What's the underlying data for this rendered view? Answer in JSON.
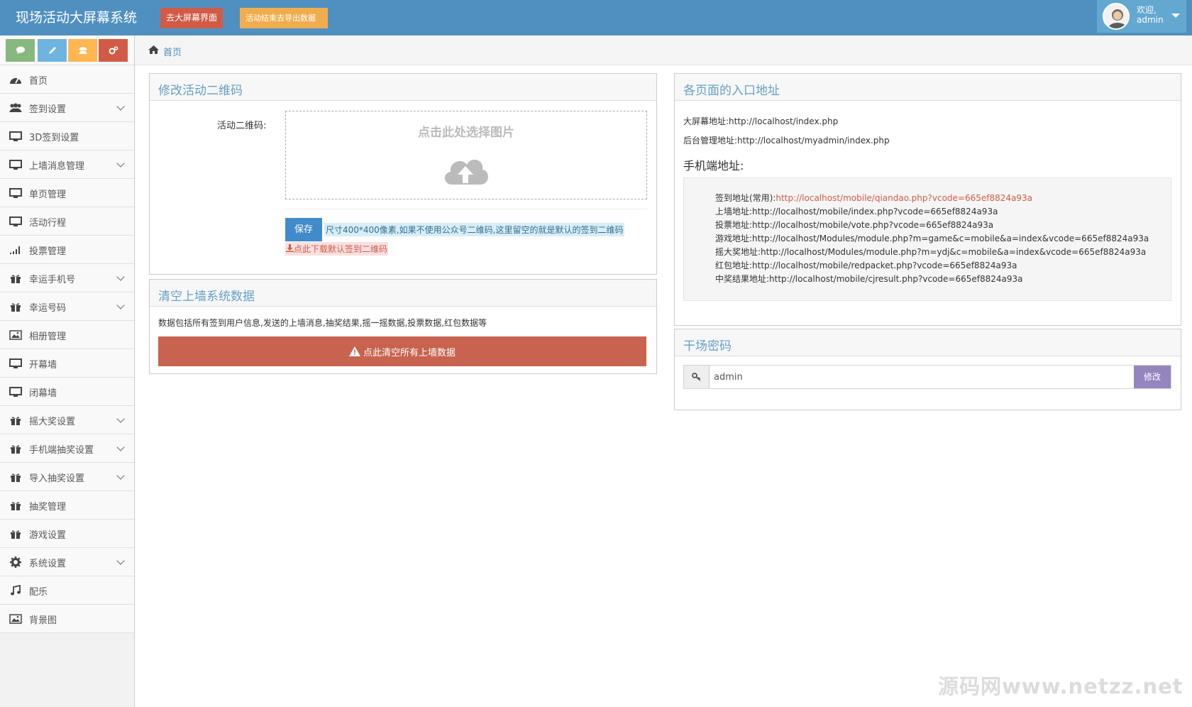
{
  "header": {
    "brand": "现场活动大屏幕系统",
    "screen_button": "去大屏幕界面",
    "export_button": "活动结束去导出数据",
    "welcome": "欢迎,",
    "user": "admin"
  },
  "sidebar": {
    "items": [
      {
        "label": "首页",
        "icon": "dashboard-icon",
        "has_children": false
      },
      {
        "label": "签到设置",
        "icon": "users-icon",
        "has_children": true
      },
      {
        "label": "3D签到设置",
        "icon": "desktop-icon",
        "has_children": false
      },
      {
        "label": "上墙消息管理",
        "icon": "desktop-icon",
        "has_children": true
      },
      {
        "label": "单页管理",
        "icon": "desktop-icon",
        "has_children": false
      },
      {
        "label": "活动行程",
        "icon": "desktop-icon",
        "has_children": false
      },
      {
        "label": "投票管理",
        "icon": "signal-icon",
        "has_children": false
      },
      {
        "label": "幸运手机号",
        "icon": "gift-icon",
        "has_children": true
      },
      {
        "label": "幸运号码",
        "icon": "gift-icon",
        "has_children": true
      },
      {
        "label": "相册管理",
        "icon": "picture-icon",
        "has_children": false
      },
      {
        "label": "开幕墙",
        "icon": "desktop-icon",
        "has_children": false
      },
      {
        "label": "闭幕墙",
        "icon": "desktop-icon",
        "has_children": false
      },
      {
        "label": "摇大奖设置",
        "icon": "gift-icon",
        "has_children": true
      },
      {
        "label": "手机端抽奖设置",
        "icon": "gift-icon",
        "has_children": true
      },
      {
        "label": "导入抽奖设置",
        "icon": "gift-icon",
        "has_children": true
      },
      {
        "label": "抽奖管理",
        "icon": "gift-icon",
        "has_children": false
      },
      {
        "label": "游戏设置",
        "icon": "gift-icon",
        "has_children": false
      },
      {
        "label": "系统设置",
        "icon": "cog-icon",
        "has_children": true
      },
      {
        "label": "配乐",
        "icon": "music-icon",
        "has_children": false
      },
      {
        "label": "背景图",
        "icon": "picture-icon",
        "has_children": false
      }
    ]
  },
  "breadcrumb": {
    "home": "首页"
  },
  "qrcode_widget": {
    "title": "修改活动二维码",
    "label": "活动二维码:",
    "upload_prompt": "点击此处选择图片",
    "save_button": "保存",
    "size_hint": "尺寸400*400像素,如果不使用公众号二维码,这里留空的就是默认的签到二维码",
    "download_link": "点此下载默认签到二维码"
  },
  "clear_widget": {
    "title": "清空上墙系统数据",
    "description": "数据包括所有签到用户信息,发送的上墙消息,抽奖结果,摇一摇数据,投票数据,红包数据等",
    "button": "点此清空所有上墙数据"
  },
  "urls_widget": {
    "title": "各页面的入口地址",
    "screen_url": "大屏幕地址:http://localhost/index.php",
    "admin_url": "后台管理地址:http://localhost/myadmin/index.php",
    "mobile_title": "手机端地址:",
    "signin_label": "签到地址(常用):",
    "signin_url": "http://localhost/mobile/qiandao.php?vcode=665ef8824a93a",
    "lines": [
      "上墙地址:http://localhost/mobile/index.php?vcode=665ef8824a93a",
      "投票地址:http://localhost/mobile/vote.php?vcode=665ef8824a93a",
      "游戏地址:http://localhost/Modules/module.php?m=game&c=mobile&a=index&vcode=665ef8824a93a",
      "摇大奖地址:http://localhost/Modules/module.php?m=ydj&c=mobile&a=index&vcode=665ef8824a93a",
      "红包地址:http://localhost/mobile/redpacket.php?vcode=665ef8824a93a",
      "中奖结果地址:http://localhost/mobile/cjresult.php?vcode=665ef8824a93a"
    ]
  },
  "password_widget": {
    "title": "干场密码",
    "value": "admin",
    "button": "修改"
  },
  "watermark": "源码网www.netzz.net"
}
